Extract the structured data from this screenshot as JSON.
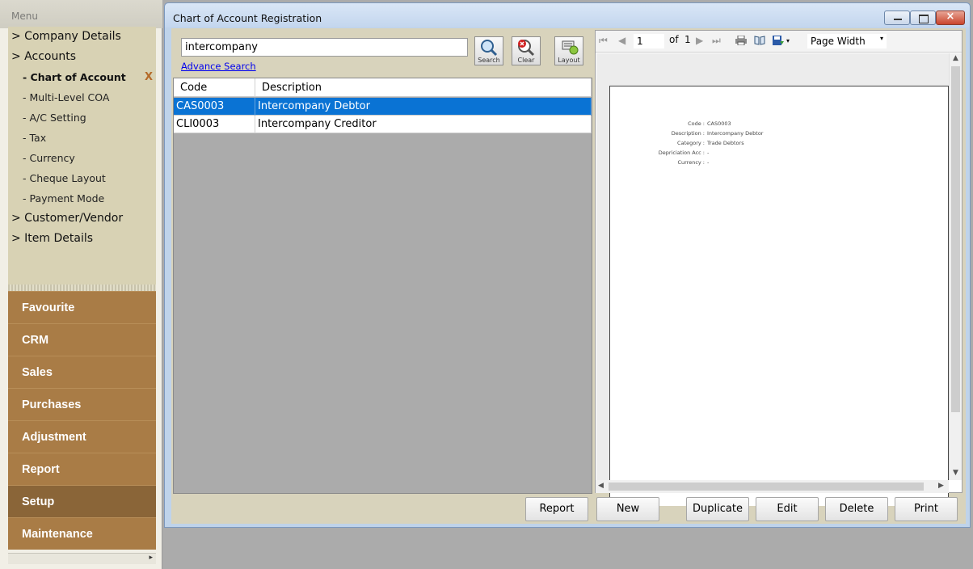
{
  "menu": {
    "title": "Menu",
    "tree": [
      {
        "label": "> Company Details"
      },
      {
        "label": "> Accounts"
      }
    ],
    "accounts_children": [
      {
        "label": "- Chart of Account"
      },
      {
        "label": "- Multi-Level COA"
      },
      {
        "label": "- A/C Setting"
      },
      {
        "label": "- Tax"
      },
      {
        "label": "- Currency"
      },
      {
        "label": "- Cheque Layout"
      },
      {
        "label": "- Payment Mode"
      }
    ],
    "tree_tail": [
      {
        "label": "> Customer/Vendor"
      },
      {
        "label": "> Item Details"
      }
    ],
    "close_mark": "X",
    "modules": [
      "Favourite",
      "CRM",
      "Sales",
      "Purchases",
      "Adjustment",
      "Report",
      "Setup",
      "Maintenance"
    ],
    "active_module": "Setup"
  },
  "window": {
    "title": "Chart of Account Registration",
    "close_glyph": "×"
  },
  "search": {
    "value": "intercompany",
    "advance_link": "Advance Search",
    "buttons": {
      "search": "Search",
      "clear": "Clear",
      "layout": "Layout"
    }
  },
  "grid": {
    "columns": [
      "Code",
      "Description"
    ],
    "rows": [
      {
        "code": "CAS0003",
        "description": "Intercompany Debtor",
        "selected": true
      },
      {
        "code": "CLI0003",
        "description": "Intercompany Creditor",
        "selected": false
      }
    ]
  },
  "viewer": {
    "page": "1",
    "of_label": "of",
    "total_pages": "1",
    "zoom": "Page Width",
    "report_fields": [
      {
        "label": "Code :",
        "value": "CAS0003"
      },
      {
        "label": "Description :",
        "value": "Intercompany Debtor"
      },
      {
        "label": "Category :",
        "value": "Trade Debtors"
      },
      {
        "label": "Depriciation Acc :",
        "value": "-"
      },
      {
        "label": "Currency :",
        "value": "-"
      }
    ]
  },
  "actions": {
    "report": "Report",
    "new": "New",
    "duplicate": "Duplicate",
    "edit": "Edit",
    "delete": "Delete",
    "print": "Print"
  },
  "colors": {
    "module_bg": "#a97c46",
    "module_active": "#8a6538",
    "selection": "#0a73d4",
    "link": "#0000ee"
  }
}
